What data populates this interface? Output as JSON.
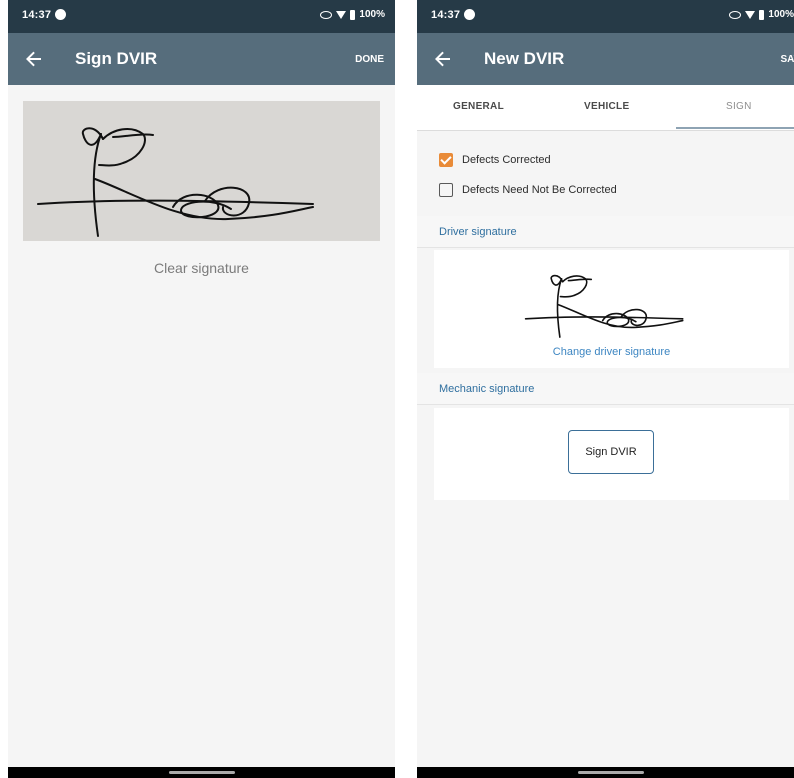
{
  "left": {
    "status": {
      "time": "14:37",
      "battery": "100%"
    },
    "appbar": {
      "title": "Sign DVIR",
      "action": "DONE"
    },
    "clear_signature": "Clear signature"
  },
  "right": {
    "status": {
      "time": "14:37",
      "battery": "100%"
    },
    "appbar": {
      "title": "New DVIR",
      "action": "SAVE"
    },
    "tabs": [
      {
        "label": "GENERAL",
        "selected": false
      },
      {
        "label": "VEHICLE",
        "selected": false
      },
      {
        "label": "SIGN",
        "selected": true
      }
    ],
    "checkboxes": [
      {
        "label": "Defects Corrected",
        "checked": true
      },
      {
        "label": "Defects Need Not Be Corrected",
        "checked": false
      }
    ],
    "driver_signature_label": "Driver signature",
    "change_driver_signature": "Change driver signature",
    "mechanic_signature_label": "Mechanic signature",
    "sign_dvir_button": "Sign DVIR"
  },
  "colors": {
    "status_bar": "#263a47",
    "app_bar": "#566d7c",
    "checkbox_accent": "#e98b38",
    "link": "#3d86c2"
  },
  "icons": [
    "back-arrow-icon",
    "app-status-icon",
    "eye-icon",
    "wifi-icon",
    "battery-icon",
    "checkbox-checked-icon",
    "checkbox-empty-icon"
  ]
}
